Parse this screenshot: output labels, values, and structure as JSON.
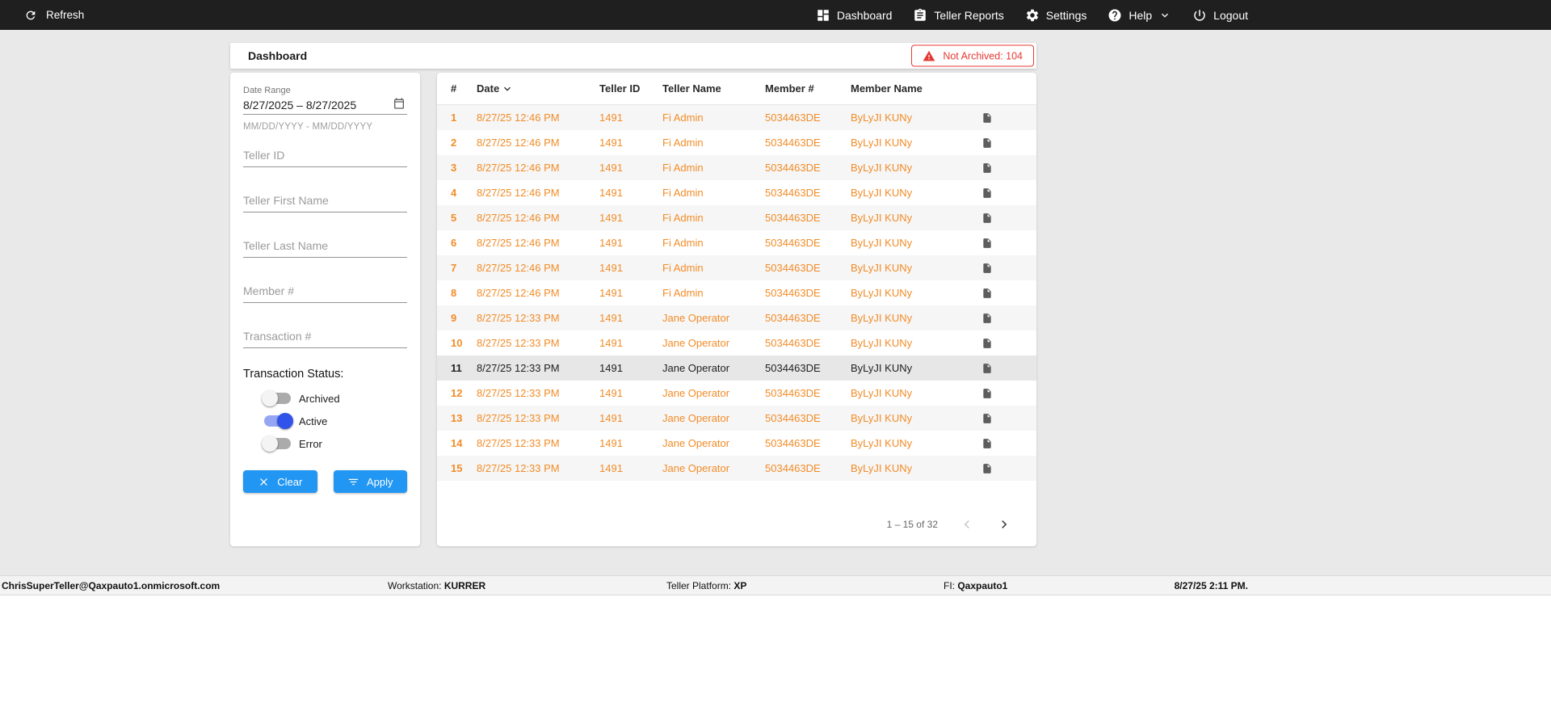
{
  "topbar": {
    "refresh_label": "Refresh",
    "nav": [
      {
        "label": "Dashboard"
      },
      {
        "label": "Teller Reports"
      },
      {
        "label": "Settings"
      },
      {
        "label": "Help"
      },
      {
        "label": "Logout"
      }
    ]
  },
  "header": {
    "title": "Dashboard",
    "not_archived_badge": "Not Archived: 104"
  },
  "filters": {
    "date_range": {
      "label": "Date Range",
      "value": "8/27/2025 – 8/27/2025",
      "hint": "MM/DD/YYYY - MM/DD/YYYY"
    },
    "inputs": [
      {
        "placeholder": "Teller ID"
      },
      {
        "placeholder": "Teller First Name"
      },
      {
        "placeholder": "Teller Last Name"
      },
      {
        "placeholder": "Member #"
      },
      {
        "placeholder": "Transaction #"
      }
    ],
    "status_label": "Transaction Status:",
    "toggles": [
      {
        "label": "Archived",
        "on": false
      },
      {
        "label": "Active",
        "on": true
      },
      {
        "label": "Error",
        "on": false
      }
    ],
    "clear_label": "Clear",
    "apply_label": "Apply"
  },
  "table": {
    "columns": [
      "#",
      "Date",
      "Teller ID",
      "Teller Name",
      "Member #",
      "Member Name"
    ],
    "sorted_by": "Date",
    "sort_direction": "desc",
    "rows": [
      {
        "num": "1",
        "date": "8/27/25 12:46 PM",
        "teller_id": "1491",
        "teller_name": "Fi Admin",
        "member_num": "5034463DE",
        "member_name": "ByLyJI KUNy",
        "selected": false
      },
      {
        "num": "2",
        "date": "8/27/25 12:46 PM",
        "teller_id": "1491",
        "teller_name": "Fi Admin",
        "member_num": "5034463DE",
        "member_name": "ByLyJI KUNy",
        "selected": false
      },
      {
        "num": "3",
        "date": "8/27/25 12:46 PM",
        "teller_id": "1491",
        "teller_name": "Fi Admin",
        "member_num": "5034463DE",
        "member_name": "ByLyJI KUNy",
        "selected": false
      },
      {
        "num": "4",
        "date": "8/27/25 12:46 PM",
        "teller_id": "1491",
        "teller_name": "Fi Admin",
        "member_num": "5034463DE",
        "member_name": "ByLyJI KUNy",
        "selected": false
      },
      {
        "num": "5",
        "date": "8/27/25 12:46 PM",
        "teller_id": "1491",
        "teller_name": "Fi Admin",
        "member_num": "5034463DE",
        "member_name": "ByLyJI KUNy",
        "selected": false
      },
      {
        "num": "6",
        "date": "8/27/25 12:46 PM",
        "teller_id": "1491",
        "teller_name": "Fi Admin",
        "member_num": "5034463DE",
        "member_name": "ByLyJI KUNy",
        "selected": false
      },
      {
        "num": "7",
        "date": "8/27/25 12:46 PM",
        "teller_id": "1491",
        "teller_name": "Fi Admin",
        "member_num": "5034463DE",
        "member_name": "ByLyJI KUNy",
        "selected": false
      },
      {
        "num": "8",
        "date": "8/27/25 12:46 PM",
        "teller_id": "1491",
        "teller_name": "Fi Admin",
        "member_num": "5034463DE",
        "member_name": "ByLyJI KUNy",
        "selected": false
      },
      {
        "num": "9",
        "date": "8/27/25 12:33 PM",
        "teller_id": "1491",
        "teller_name": "Jane Operator",
        "member_num": "5034463DE",
        "member_name": "ByLyJI KUNy",
        "selected": false
      },
      {
        "num": "10",
        "date": "8/27/25 12:33 PM",
        "teller_id": "1491",
        "teller_name": "Jane Operator",
        "member_num": "5034463DE",
        "member_name": "ByLyJI KUNy",
        "selected": false
      },
      {
        "num": "11",
        "date": "8/27/25 12:33 PM",
        "teller_id": "1491",
        "teller_name": "Jane Operator",
        "member_num": "5034463DE",
        "member_name": "ByLyJI KUNy",
        "selected": true
      },
      {
        "num": "12",
        "date": "8/27/25 12:33 PM",
        "teller_id": "1491",
        "teller_name": "Jane Operator",
        "member_num": "5034463DE",
        "member_name": "ByLyJI KUNy",
        "selected": false
      },
      {
        "num": "13",
        "date": "8/27/25 12:33 PM",
        "teller_id": "1491",
        "teller_name": "Jane Operator",
        "member_num": "5034463DE",
        "member_name": "ByLyJI KUNy",
        "selected": false
      },
      {
        "num": "14",
        "date": "8/27/25 12:33 PM",
        "teller_id": "1491",
        "teller_name": "Jane Operator",
        "member_num": "5034463DE",
        "member_name": "ByLyJI KUNy",
        "selected": false
      },
      {
        "num": "15",
        "date": "8/27/25 12:33 PM",
        "teller_id": "1491",
        "teller_name": "Jane Operator",
        "member_num": "5034463DE",
        "member_name": "ByLyJI KUNy",
        "selected": false
      }
    ],
    "pagination": {
      "label": "1 – 15 of 32"
    }
  },
  "footer": {
    "user": "ChrisSuperTeller@Qaxpauto1.onmicrosoft.com",
    "workstation_label": "Workstation:",
    "workstation_value": "KURRER",
    "platform_label": "Teller Platform:",
    "platform_value": "XP",
    "fi_label": "FI:",
    "fi_value": "Qaxpauto1",
    "datetime": "8/27/25 2:11 PM."
  },
  "colors": {
    "topbar_bg": "#1F1F1F",
    "accent_orange": "#F28C28",
    "primary_blue": "#2196F3",
    "alert_red": "#E53935",
    "toggle_on_blue": "#3053E9",
    "main_bg": "#E9E9E9"
  }
}
